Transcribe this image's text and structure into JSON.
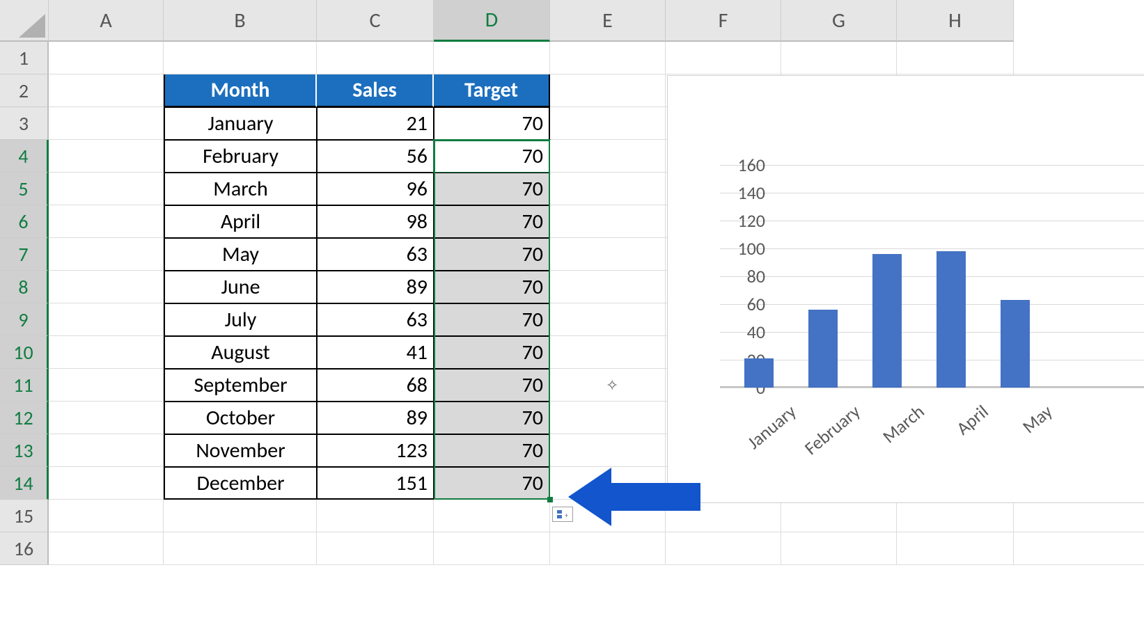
{
  "columns": [
    "A",
    "B",
    "C",
    "D",
    "E",
    "F",
    "G",
    "H"
  ],
  "rows": [
    "1",
    "2",
    "3",
    "4",
    "5",
    "6",
    "7",
    "8",
    "9",
    "10",
    "11",
    "12",
    "13",
    "14",
    "15",
    "16"
  ],
  "headers": {
    "month": "Month",
    "sales": "Sales",
    "target": "Target"
  },
  "data": [
    {
      "month": "January",
      "sales": "21",
      "target": "70"
    },
    {
      "month": "February",
      "sales": "56",
      "target": "70"
    },
    {
      "month": "March",
      "sales": "96",
      "target": "70"
    },
    {
      "month": "April",
      "sales": "98",
      "target": "70"
    },
    {
      "month": "May",
      "sales": "63",
      "target": "70"
    },
    {
      "month": "June",
      "sales": "89",
      "target": "70"
    },
    {
      "month": "July",
      "sales": "63",
      "target": "70"
    },
    {
      "month": "August",
      "sales": "41",
      "target": "70"
    },
    {
      "month": "September",
      "sales": "68",
      "target": "70"
    },
    {
      "month": "October",
      "sales": "89",
      "target": "70"
    },
    {
      "month": "November",
      "sales": "123",
      "target": "70"
    },
    {
      "month": "December",
      "sales": "151",
      "target": "70"
    }
  ],
  "selected_column": "D",
  "selected_rows_start": 4,
  "selected_rows_end": 14,
  "chart_data": {
    "type": "bar",
    "categories": [
      "January",
      "February",
      "March",
      "April",
      "May"
    ],
    "values": [
      21,
      56,
      96,
      98,
      63
    ],
    "yticks": [
      0,
      20,
      40,
      60,
      80,
      100,
      120,
      140,
      160
    ],
    "ylim": [
      0,
      160
    ],
    "bar_color": "#4472c4",
    "visible_bars": 5
  }
}
